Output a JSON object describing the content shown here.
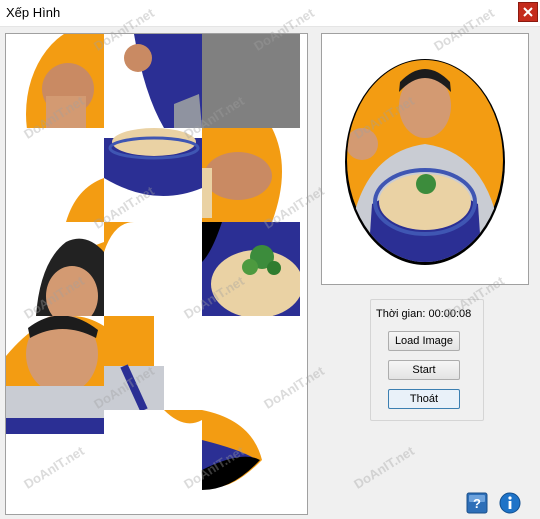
{
  "window": {
    "title": "Xếp Hình",
    "close_icon": "close-icon"
  },
  "game": {
    "board_description": "3x5 sliding tile puzzle",
    "timer_label": "Thời gian:",
    "timer_value": "00:00:08",
    "buttons": {
      "load_image": "Load Image",
      "start": "Start",
      "exit": "Thoát"
    }
  },
  "footer": {
    "help_icon": "help-icon",
    "info_icon": "info-icon"
  },
  "watermark": {
    "text": "DoAnIT.net"
  },
  "colors": {
    "orange": "#f39c12",
    "shirt_blue": "#2b2f94",
    "empty_tile": "#808080",
    "close_red": "#c42b1c",
    "help_blue": "#2e6fb8",
    "info_blue": "#1e73c8"
  }
}
